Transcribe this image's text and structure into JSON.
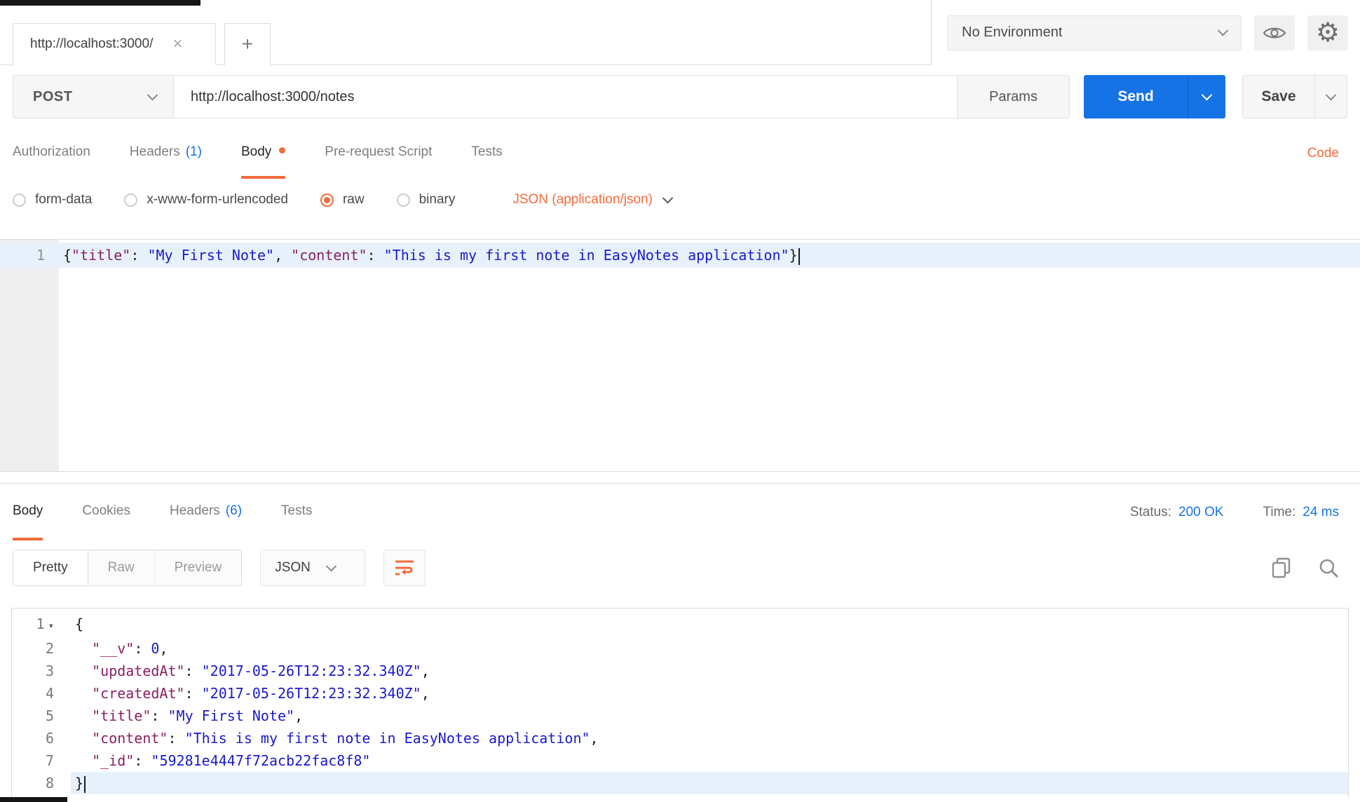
{
  "colors": {
    "accent_orange": "#f26b3a",
    "primary_blue": "#1673e6",
    "line_highlight": "#e7f1fb"
  },
  "topbar": {
    "tab_title": "http://localhost:3000/",
    "tab_close": "×",
    "new_tab": "+",
    "environment_selected": "No Environment"
  },
  "request": {
    "method": "POST",
    "url": "http://localhost:3000/notes",
    "params_label": "Params",
    "send_label": "Send",
    "save_label": "Save",
    "tabs": {
      "authorization": "Authorization",
      "headers": "Headers",
      "headers_count": "(1)",
      "body": "Body",
      "prerequest": "Pre-request Script",
      "tests": "Tests"
    },
    "code_link": "Code",
    "body_types": {
      "form_data": "form-data",
      "urlencoded": "x-www-form-urlencoded",
      "raw": "raw",
      "binary": "binary"
    },
    "content_type": "JSON (application/json)"
  },
  "request_editor": {
    "lines": [
      {
        "num": "1",
        "active": true,
        "cursor": true,
        "tokens": [
          {
            "t": "{",
            "c": "p"
          },
          {
            "t": "\"title\"",
            "c": "k"
          },
          {
            "t": ": ",
            "c": "p"
          },
          {
            "t": "\"My First Note\"",
            "c": "s"
          },
          {
            "t": ", ",
            "c": "p"
          },
          {
            "t": "\"content\"",
            "c": "k"
          },
          {
            "t": ": ",
            "c": "p"
          },
          {
            "t": "\"This is my first note in EasyNotes application\"",
            "c": "s"
          },
          {
            "t": "}",
            "c": "p"
          }
        ]
      }
    ]
  },
  "response": {
    "tabs": {
      "body": "Body",
      "cookies": "Cookies",
      "headers": "Headers",
      "headers_count": "(6)",
      "tests": "Tests"
    },
    "status_label": "Status:",
    "status_value": "200 OK",
    "time_label": "Time:",
    "time_value": "24 ms",
    "modes": {
      "pretty": "Pretty",
      "raw": "Raw",
      "preview": "Preview"
    },
    "format": "JSON"
  },
  "response_editor": {
    "lines": [
      {
        "num": "1",
        "fold": true,
        "tokens": [
          {
            "t": "{",
            "c": "p"
          }
        ]
      },
      {
        "num": "2",
        "tokens": [
          {
            "t": "  ",
            "c": "p"
          },
          {
            "t": "\"__v\"",
            "c": "k"
          },
          {
            "t": ": ",
            "c": "p"
          },
          {
            "t": "0",
            "c": "n"
          },
          {
            "t": ",",
            "c": "p"
          }
        ]
      },
      {
        "num": "3",
        "tokens": [
          {
            "t": "  ",
            "c": "p"
          },
          {
            "t": "\"updatedAt\"",
            "c": "k"
          },
          {
            "t": ": ",
            "c": "p"
          },
          {
            "t": "\"2017-05-26T12:23:32.340Z\"",
            "c": "s"
          },
          {
            "t": ",",
            "c": "p"
          }
        ]
      },
      {
        "num": "4",
        "tokens": [
          {
            "t": "  ",
            "c": "p"
          },
          {
            "t": "\"createdAt\"",
            "c": "k"
          },
          {
            "t": ": ",
            "c": "p"
          },
          {
            "t": "\"2017-05-26T12:23:32.340Z\"",
            "c": "s"
          },
          {
            "t": ",",
            "c": "p"
          }
        ]
      },
      {
        "num": "5",
        "tokens": [
          {
            "t": "  ",
            "c": "p"
          },
          {
            "t": "\"title\"",
            "c": "k"
          },
          {
            "t": ": ",
            "c": "p"
          },
          {
            "t": "\"My First Note\"",
            "c": "s"
          },
          {
            "t": ",",
            "c": "p"
          }
        ]
      },
      {
        "num": "6",
        "tokens": [
          {
            "t": "  ",
            "c": "p"
          },
          {
            "t": "\"content\"",
            "c": "k"
          },
          {
            "t": ": ",
            "c": "p"
          },
          {
            "t": "\"This is my first note in EasyNotes application\"",
            "c": "s"
          },
          {
            "t": ",",
            "c": "p"
          }
        ]
      },
      {
        "num": "7",
        "tokens": [
          {
            "t": "  ",
            "c": "p"
          },
          {
            "t": "\"_id\"",
            "c": "k"
          },
          {
            "t": ": ",
            "c": "p"
          },
          {
            "t": "\"59281e4447f72acb22fac8f8\"",
            "c": "s"
          }
        ]
      },
      {
        "num": "8",
        "active": true,
        "cursor": true,
        "tokens": [
          {
            "t": "}",
            "c": "p"
          }
        ]
      }
    ]
  }
}
